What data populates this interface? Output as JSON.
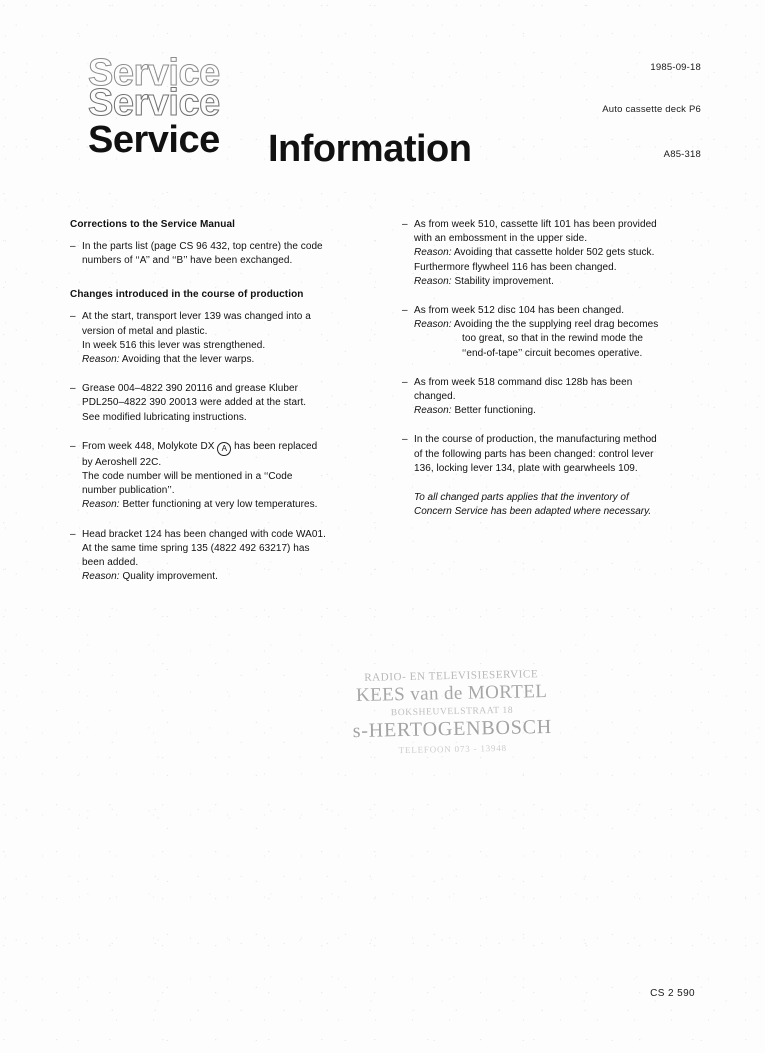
{
  "masthead": {
    "ghost_1": "Service",
    "ghost_2": "Service",
    "solid": "Service",
    "headline": "Information"
  },
  "meta": {
    "date": "1985-09-18",
    "model": "Auto cassette deck P6",
    "doc_code": "A85-318"
  },
  "left_column": {
    "corrections_heading": "Corrections to the Service Manual",
    "corrections_item": {
      "line_1": "In the parts list (page CS 96 432, top centre) the code",
      "line_2": "numbers of ‘‘A’’ and ‘‘B’’ have been exchanged."
    },
    "changes_heading": "Changes introduced in the course of production",
    "items": [
      {
        "line_1": "At the start, transport lever 139 was changed into a",
        "line_2": "version of metal and plastic.",
        "line_3": "In week 516 this lever was strengthened.",
        "reason_label": "Reason:",
        "reason_text": " Avoiding that the lever warps."
      },
      {
        "line_1": "Grease 004–4822 390 20116 and grease Kluber",
        "line_2": "PDL250–4822 390 20013 were added at the start.",
        "line_3": "See modified lubricating instructions."
      },
      {
        "line_1a": "From week 448, Molykote DX ",
        "circle_symbol": "A",
        "line_1b": " has been replaced",
        "line_2": "by Aeroshell 22C.",
        "line_3": "The code number will be mentioned in a ‘‘Code",
        "line_4": "number publication’’.",
        "reason_label": "Reason:",
        "reason_text": " Better functioning at very low temperatures."
      },
      {
        "line_1": "Head bracket 124 has been changed with code WA01.",
        "line_2": "At the same time spring 135 (4822 492 63217) has",
        "line_3": "been added.",
        "reason_label": "Reason:",
        "reason_text": " Quality improvement."
      }
    ]
  },
  "right_column": {
    "items": [
      {
        "line_1": "As from week 510, cassette lift 101 has been provided",
        "line_2": "with an embossment in the upper side.",
        "reason_label": "Reason:",
        "reason_text": " Avoiding that cassette holder 502 gets stuck.",
        "extra_line": "Furthermore flywheel 116 has been changed.",
        "extra_reason_label": "Reason:",
        "extra_reason_text": " Stability improvement."
      },
      {
        "line_1": "As from week 512 disc 104 has been changed.",
        "reason_label": "Reason:",
        "reason_text": " Avoiding the the supplying reel drag becomes",
        "reason_cont_1": "too great, so that in the rewind mode the",
        "reason_cont_2": "‘‘end-of-tape’’ circuit becomes operative."
      },
      {
        "line_1": "As from week 518 command disc 128b has been",
        "line_2": "changed.",
        "reason_label": "Reason:",
        "reason_text": " Better functioning."
      },
      {
        "line_1": "In the course of production, the manufacturing method",
        "line_2": "of the following parts has been changed: control lever",
        "line_3": "136, locking lever 134, plate with gearwheels 109."
      }
    ],
    "closing_note": {
      "line_1": "To all changed parts applies that the inventory of",
      "line_2": "Concern Service has been adapted where necessary."
    }
  },
  "stamp": {
    "line_1": "RADIO- EN TELEVISIESERVICE",
    "line_2": "KEES van de MORTEL",
    "line_3": "BOKSHEUVELSTRAAT 18",
    "line_4": "s-HERTOGENBOSCH",
    "line_5": "TELEFOON 073 - 13948"
  },
  "footer": {
    "code": "CS 2 590"
  }
}
